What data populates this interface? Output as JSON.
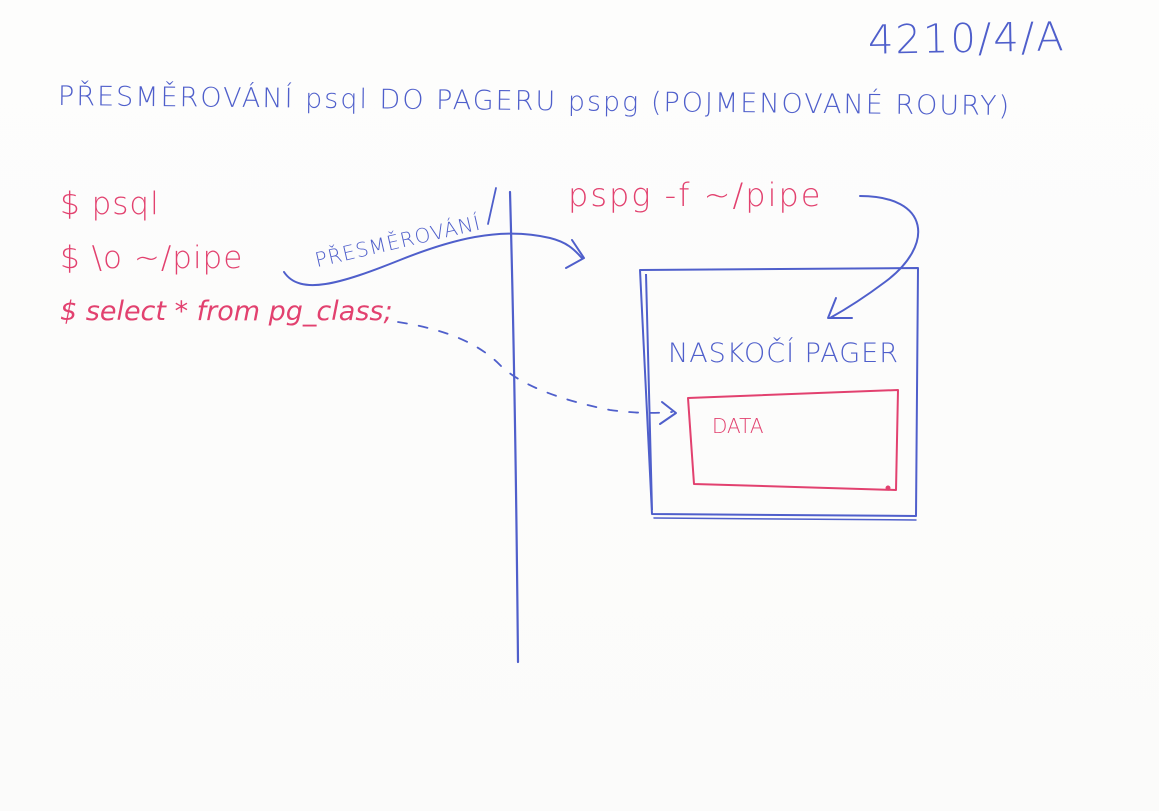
{
  "sheet_id": "4210/4/A",
  "title": "PŘESMĚROVÁNÍ psql DO PAGERU pspg (POJMENOVANÉ ROURY)",
  "left_panel": {
    "commands": [
      "$ psql",
      "$ \\o ~/pipe",
      "$ select * from pg_class;"
    ],
    "arrow_label": "PŘESMĚROVÁNÍ"
  },
  "right_panel": {
    "command": "pspg -f ~/pipe",
    "pager_label": "NASKOČÍ PAGER",
    "data_label": "DATA"
  },
  "colors": {
    "blue_ink": "#4f5fcb",
    "red_ink": "#e2416f"
  }
}
